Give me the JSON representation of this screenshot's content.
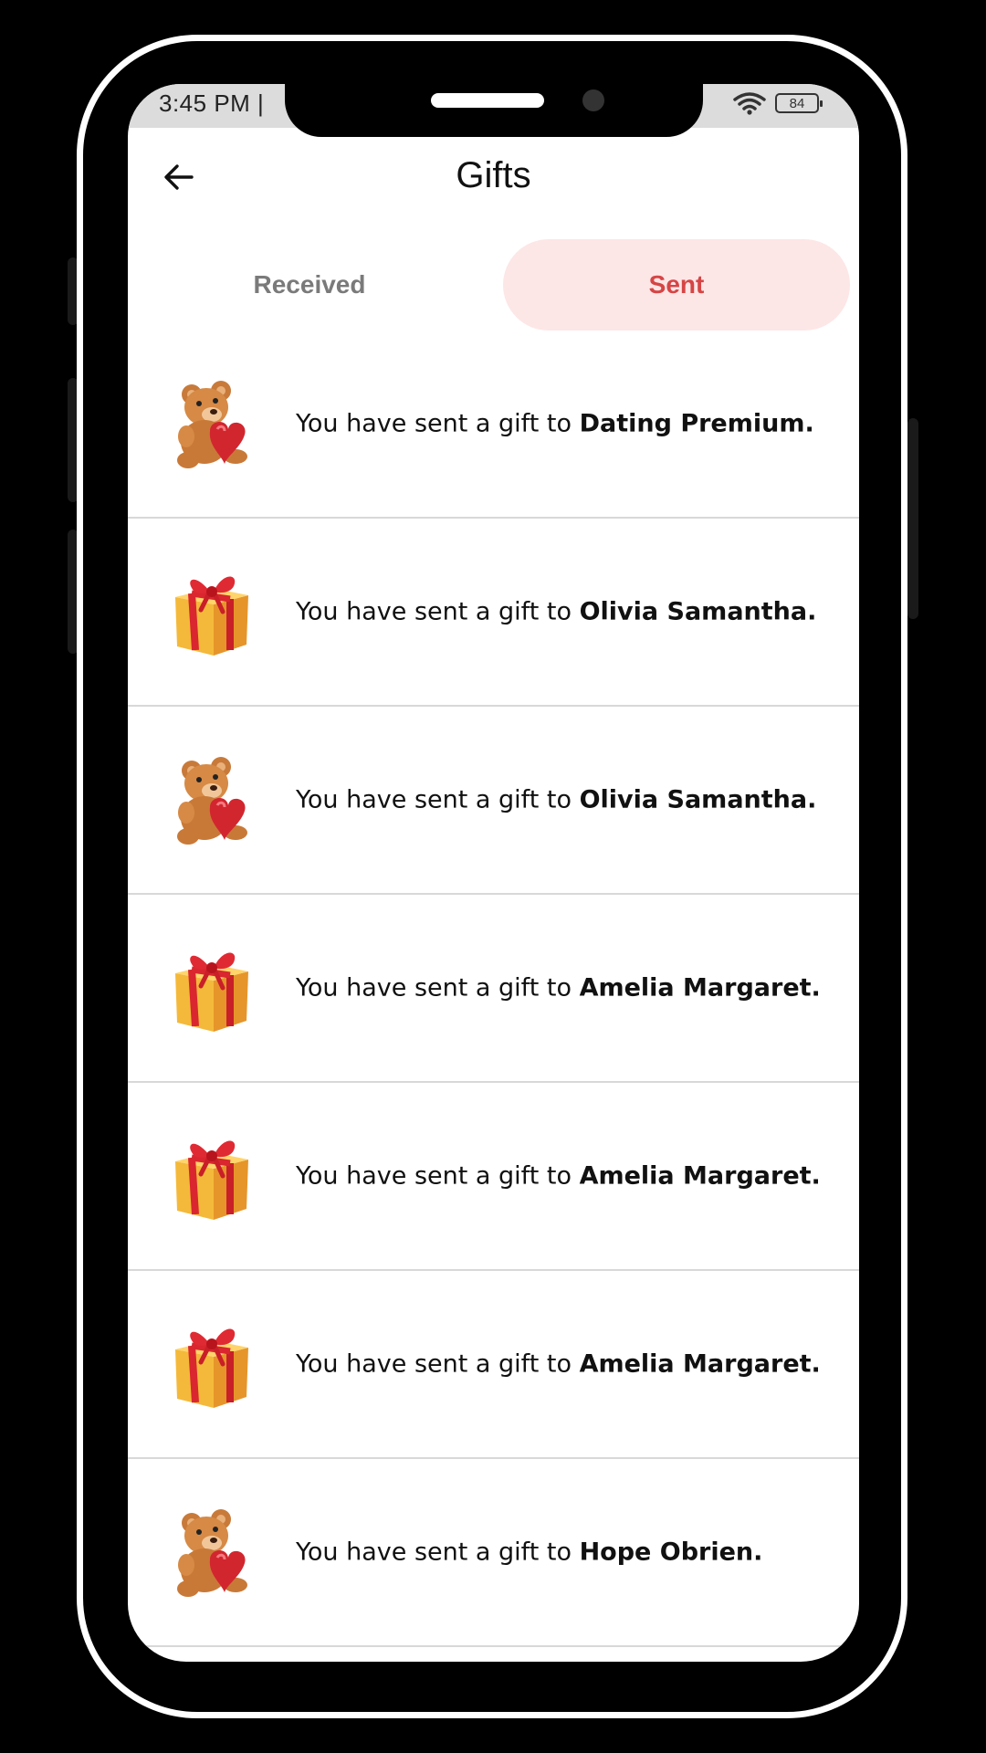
{
  "status_bar": {
    "time": "3:45 PM |",
    "battery": "84"
  },
  "header": {
    "title": "Gifts"
  },
  "tabs": [
    {
      "label": "Received",
      "active": false
    },
    {
      "label": "Sent",
      "active": true
    }
  ],
  "colors": {
    "accent": "#d64545",
    "accent_bg": "#fde6e6",
    "divider": "#d8d8d8"
  },
  "gifts": [
    {
      "icon": "teddy-bear-heart-icon",
      "prefix": "You have sent a gift to",
      "name": "Dating Premium."
    },
    {
      "icon": "gift-box-icon",
      "prefix": "You have sent a gift to",
      "name": "Olivia Samantha."
    },
    {
      "icon": "teddy-bear-heart-icon",
      "prefix": "You have sent a gift to",
      "name": "Olivia Samantha."
    },
    {
      "icon": "gift-box-icon",
      "prefix": "You have sent a gift to",
      "name": "Amelia Margaret."
    },
    {
      "icon": "gift-box-icon",
      "prefix": "You have sent a gift to",
      "name": "Amelia Margaret."
    },
    {
      "icon": "gift-box-icon",
      "prefix": "You have sent a gift to",
      "name": "Amelia Margaret."
    },
    {
      "icon": "teddy-bear-heart-icon",
      "prefix": "You have sent a gift to",
      "name": "Hope Obrien."
    }
  ]
}
